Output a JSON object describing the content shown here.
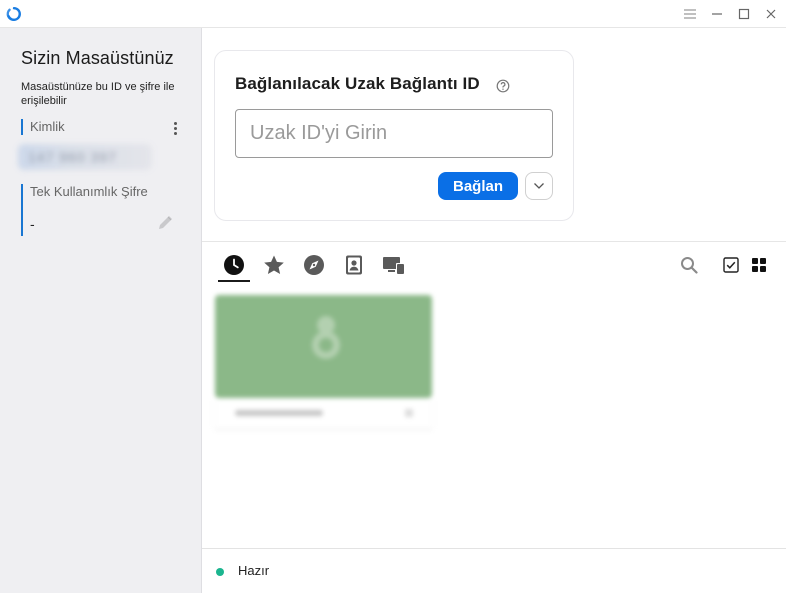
{
  "app": {
    "accent_color": "#0a6fe6",
    "logo_icon": "app-logo-icon"
  },
  "titlebar": {
    "menu_icon": "hamburger-icon",
    "minimize_icon": "minimize-icon",
    "maximize_icon": "maximize-icon",
    "close_icon": "close-icon"
  },
  "sidebar": {
    "title": "Sizin Masaüstünüz",
    "description": "Masaüstünüze bu ID ve şifre ile erişilebilir",
    "id_label": "Kimlik",
    "id_value": "147 960 397",
    "password_label": "Tek Kullanımlık Şifre",
    "password_value": "-"
  },
  "connect": {
    "title": "Bağlanılacak Uzak Bağlantı ID",
    "input_placeholder": "Uzak ID'yi Girin",
    "input_value": "",
    "connect_label": "Bağlan"
  },
  "tabs": [
    {
      "icon": "history-clock-icon",
      "active": true
    },
    {
      "icon": "favorites-star-icon",
      "active": false
    },
    {
      "icon": "discovered-compass-icon",
      "active": false
    },
    {
      "icon": "address-book-icon",
      "active": false
    },
    {
      "icon": "group-devices-icon",
      "active": false
    }
  ],
  "toolbar": {
    "search_icon": "search-icon",
    "select_icon": "checkbox-icon",
    "view_icon": "grid-view-icon"
  },
  "status": {
    "text": "Hazır",
    "color": "#1bb58f"
  }
}
